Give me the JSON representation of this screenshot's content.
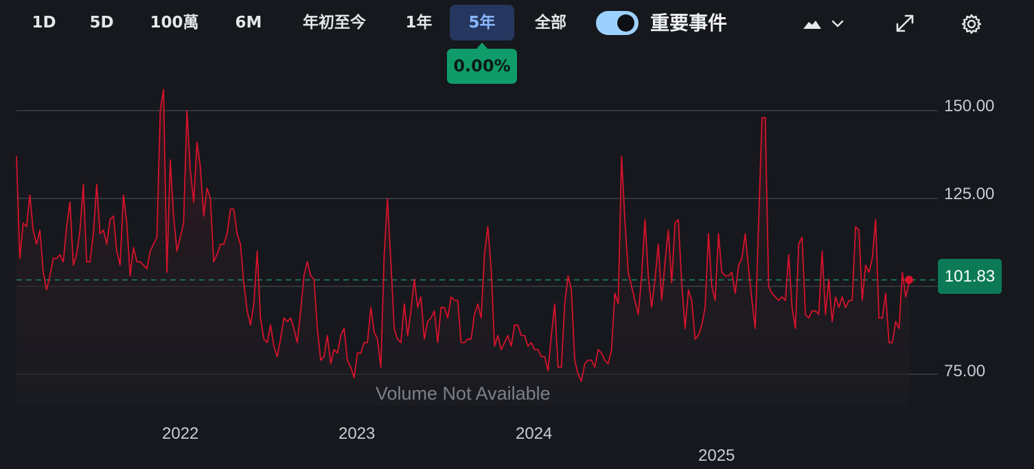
{
  "toolbar": {
    "ranges": [
      "1D",
      "5D",
      "100萬",
      "6M",
      "年初至今",
      "1年",
      "5年",
      "全部"
    ],
    "active_range": "5年",
    "change_pct": "0.00%",
    "events_toggle_label": "重要事件",
    "events_toggle_on": true,
    "icons": [
      "area-chart-icon",
      "chevron-down-icon",
      "expand-icon",
      "settings-gear-icon"
    ]
  },
  "colors": {
    "line": "#d6132b",
    "positive_badge": "#0f9c6a",
    "price_badge": "#0c7a57",
    "active_tab_bg": "#26375f",
    "active_tab_text": "#8ab8ff",
    "toggle": "#9cd1ff",
    "gridline": "#3d4047",
    "reference_dash": "#1d8a64"
  },
  "chart_data": {
    "type": "line",
    "title": "",
    "xlabel": "",
    "ylabel": "",
    "yticks": [
      "150.00",
      "125.00",
      "75.00"
    ],
    "ylim": [
      66,
      168
    ],
    "xticks": [
      "2022",
      "2023",
      "2024",
      "2025"
    ],
    "last_price": "101.83",
    "reference_line": 101.83,
    "volume_note": "Volume Not Available",
    "grid": true,
    "series": [
      {
        "values": [
          137,
          108,
          118,
          117,
          126,
          116,
          112,
          116,
          104,
          99,
          103,
          108,
          108,
          109,
          107,
          117,
          124,
          106,
          109,
          116,
          129,
          107,
          107,
          115,
          129,
          115,
          116,
          112,
          119,
          120,
          110,
          106,
          126,
          118,
          103,
          111,
          107,
          107,
          106,
          105,
          110,
          112,
          114,
          150,
          156,
          104,
          136,
          120,
          110,
          114,
          118,
          150,
          133,
          124,
          141,
          134,
          120,
          128,
          125,
          107,
          109,
          112,
          112,
          115,
          122,
          122,
          115,
          112,
          101,
          93,
          89,
          95,
          110,
          91,
          85,
          84,
          89,
          83,
          80,
          85,
          91,
          90,
          91,
          88,
          84,
          93,
          103,
          107,
          103,
          102,
          88,
          79,
          80,
          86,
          78,
          82,
          81,
          86,
          88,
          79,
          77,
          74,
          81,
          81,
          84,
          84,
          94,
          87,
          85,
          77,
          109,
          125,
          107,
          88,
          85,
          84,
          95,
          86,
          93,
          102,
          94,
          97,
          85,
          90,
          91,
          93,
          84,
          94,
          94,
          91,
          97,
          96,
          96,
          84,
          84,
          85,
          85,
          92,
          95,
          91,
          109,
          117,
          105,
          83,
          86,
          82,
          84,
          86,
          83,
          89,
          89,
          86,
          86,
          83,
          84,
          82,
          82,
          80,
          80,
          76,
          86,
          95,
          77,
          77,
          95,
          103,
          99,
          79,
          75,
          73,
          78,
          79,
          79,
          77,
          82,
          81,
          79,
          78,
          82,
          98,
          95,
          137,
          119,
          104,
          100,
          96,
          92,
          103,
          119,
          103,
          94,
          102,
          112,
          96,
          107,
          116,
          101,
          118,
          119,
          101,
          88,
          99,
          96,
          85,
          86,
          89,
          94,
          115,
          100,
          96,
          115,
          104,
          103,
          103,
          104,
          98,
          106,
          108,
          115,
          105,
          96,
          88,
          118,
          148,
          148,
          100,
          98,
          97,
          96,
          97,
          96,
          109,
          94,
          88,
          112,
          114,
          92,
          91,
          93,
          93,
          92,
          110,
          92,
          102,
          90,
          97,
          94,
          97,
          94,
          96,
          96,
          117,
          116,
          96,
          106,
          104,
          108,
          119,
          91,
          91,
          98,
          84,
          84,
          90,
          88,
          104,
          97,
          101
        ]
      }
    ]
  },
  "chart_style": {
    "plot_left": 24,
    "plot_right": 1324,
    "y_top_value": 168,
    "y_bottom_value": 66
  }
}
